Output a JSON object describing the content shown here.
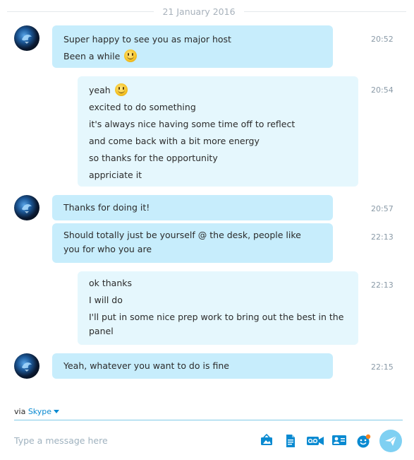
{
  "conversation": {
    "date": "21 January 2016",
    "messages": [
      {
        "direction": "in",
        "time": "20:52",
        "lines": [
          "Super happy to see you as major host",
          "Been a while"
        ],
        "emoji_after_line": 1
      },
      {
        "direction": "out",
        "time": "20:54",
        "lines": [
          "yeah",
          "excited to do something",
          "it's always nice having some time off to reflect",
          "and come back with a bit more energy",
          "so thanks for the opportunity",
          "appriciate it"
        ],
        "emoji_after_line": 0
      },
      {
        "direction": "in",
        "time": "20:57",
        "lines": [
          "Thanks for doing it!"
        ]
      },
      {
        "direction": "in",
        "time": "22:13",
        "text": "Should totally just be yourself @ the desk, people like you for who you are"
      },
      {
        "direction": "out",
        "time": "22:13",
        "lines": [
          "ok thanks",
          "I will do"
        ],
        "text": "I'll put in some nice prep work to bring out the best in the panel"
      },
      {
        "direction": "in",
        "time": "22:15",
        "lines": [
          "Yeah, whatever you want to do is fine"
        ]
      }
    ]
  },
  "composer": {
    "via_label": "via",
    "service": "Skype",
    "placeholder": "Type a message here",
    "icons": [
      "media-share-icon",
      "file-icon",
      "video-message-icon",
      "contact-card-icon",
      "emoticon-icon",
      "send-icon"
    ]
  },
  "colors": {
    "incoming_bubble": "#c7edfc",
    "outgoing_bubble": "#e5f7fd",
    "accent": "#0a8ad1",
    "send_button": "#7fd0f2"
  }
}
